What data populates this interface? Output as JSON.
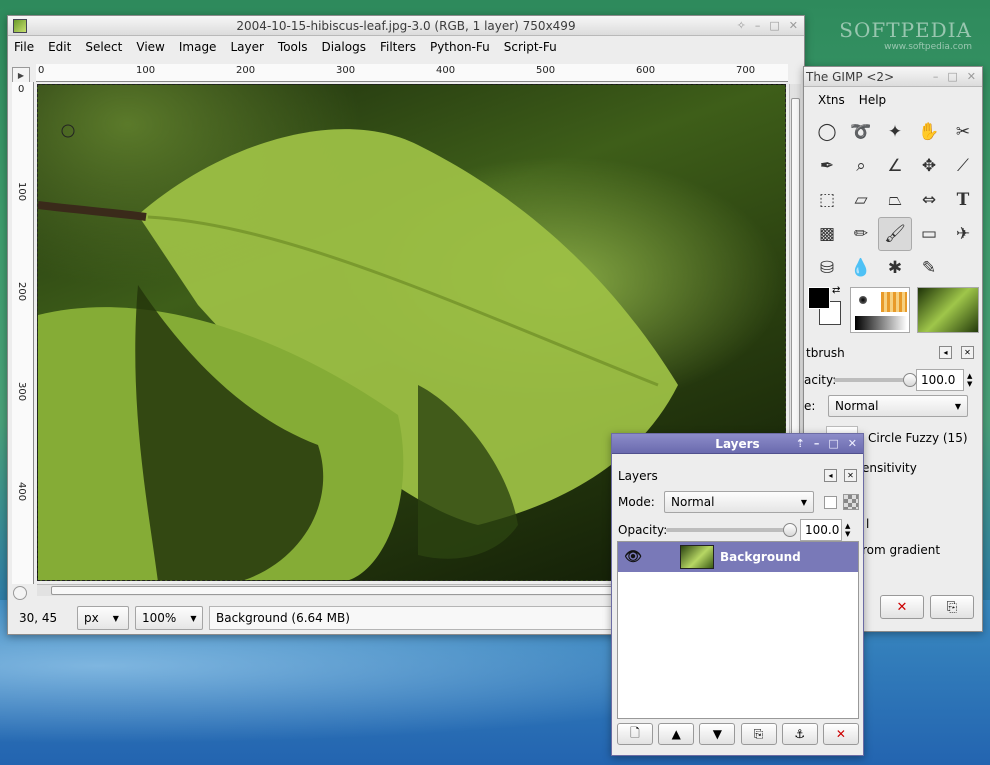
{
  "image_window": {
    "title": "2004-10-15-hibiscus-leaf.jpg-3.0 (RGB, 1 layer) 750x499",
    "menu": [
      "File",
      "Edit",
      "Select",
      "View",
      "Image",
      "Layer",
      "Tools",
      "Dialogs",
      "Filters",
      "Python-Fu",
      "Script-Fu"
    ],
    "ruler_top": [
      "0",
      "100",
      "200",
      "300",
      "400",
      "500",
      "600",
      "700"
    ],
    "ruler_left": [
      "0",
      "100",
      "200",
      "300",
      "400"
    ],
    "status": {
      "coords": "30, 45",
      "unit": "px",
      "zoom": "100%",
      "message": "Background (6.64 MB)"
    }
  },
  "toolbox": {
    "title": "The GIMP <2>",
    "menu": [
      "Xtns",
      "Help"
    ],
    "tools": [
      "ellipse-select-icon",
      "free-select-icon",
      "fuzzy-select-icon",
      "color-select-icon",
      "scissors-icon",
      "color-picker-icon",
      "zoom-icon",
      "measure-icon",
      "move-icon",
      "crop-icon",
      "transform-icon",
      "perspective-icon",
      "flip-icon",
      "align-icon",
      "text-tool-icon",
      "blend-icon",
      "pencil-icon",
      "paintbrush-icon",
      "eraser-icon",
      "airbrush-icon",
      "clone-icon",
      "smudge-icon",
      "heal-icon",
      "ink-icon"
    ],
    "tool_options": {
      "heading": "tbrush",
      "opacity_label": "acity:",
      "opacity_value": "100.0",
      "opacity_fraction": 1.0,
      "mode_label": "e:",
      "mode_value": "Normal",
      "brush_value": "Circle Fuzzy (15)",
      "sensitivity_label": "ensitivity",
      "fade_label": "l",
      "gradient_label": "rom gradient"
    }
  },
  "layers": {
    "title": "Layers",
    "tab_label": "Layers",
    "mode_label": "Mode:",
    "mode_value": "Normal",
    "opacity_label": "Opacity:",
    "opacity_value": "100.0",
    "opacity_fraction": 1.0,
    "layer_list": [
      {
        "name": "Background",
        "visible": true
      }
    ]
  },
  "watermark": {
    "brand": "SOFTPEDIA",
    "url": "www.softpedia.com"
  }
}
